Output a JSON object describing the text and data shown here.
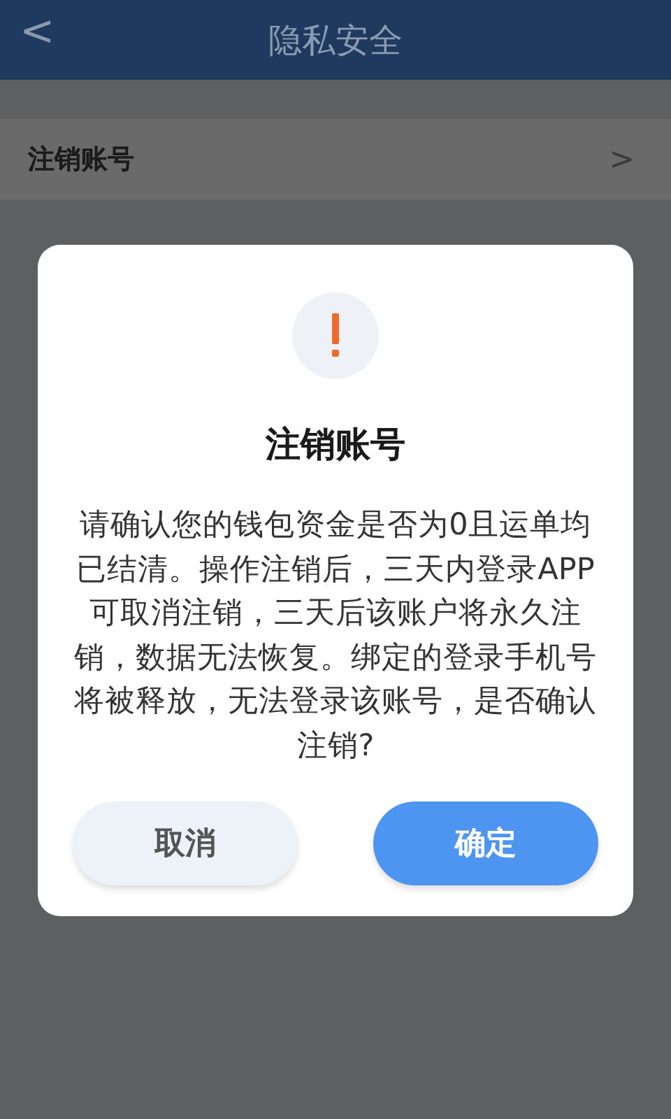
{
  "header": {
    "back": "<",
    "title": "隐私安全"
  },
  "settings_rows": [
    {
      "label": "注销账号",
      "chevron": ">"
    }
  ],
  "dialog": {
    "title": "注销账号",
    "message": "请确认您的钱包资金是否为0且运单均已结清。操作注销后，三天内登录APP可取消注销，三天后该账户将永久注销，数据无法恢复。绑定的登录手机号将被释放，无法登录该账号，是否确认注销?",
    "buttons": [
      {
        "label": "取消",
        "kind": "secondary"
      },
      {
        "label": "确定",
        "kind": "primary"
      }
    ]
  }
}
